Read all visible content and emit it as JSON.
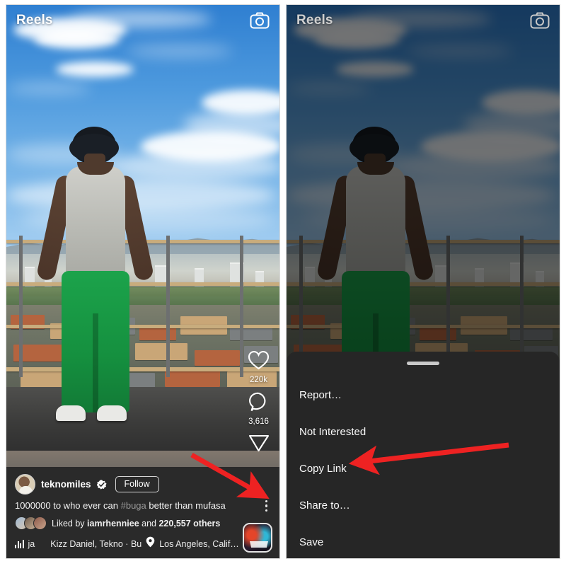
{
  "app": {
    "name": "Instagram Reels",
    "screen_title": "Reels"
  },
  "colors": {
    "annotation_arrow": "#ee2222",
    "sheet_background": "#262626",
    "caption_background": "#2a2a2a",
    "panel_background": "#000000",
    "text_primary": "#ffffff",
    "hashtag": "#9a9a9a"
  },
  "left_panel": {
    "label": "reels-feed-screen",
    "topbar": {
      "title": "Reels",
      "camera_icon": "camera-icon"
    },
    "actions": [
      {
        "icon": "heart-icon",
        "name": "like-button",
        "count": "220k"
      },
      {
        "icon": "comment-icon",
        "name": "comment-button",
        "count": "3,616"
      },
      {
        "icon": "share-icon",
        "name": "share-button",
        "count": ""
      }
    ],
    "post": {
      "username": "teknomiles",
      "verified_icon": "verified-badge-icon",
      "follow_label": "Follow",
      "caption_before_tag": "1000000 to who ever can ",
      "caption_hashtag": "#buga",
      "caption_after_tag": " better than mufasa",
      "more_options_icon": "three-dot-menu-icon",
      "liked_by_prefix": "Liked by ",
      "liked_by_user": "iamrhenniee",
      "liked_by_middle": " and ",
      "liked_by_count": "220,557 others",
      "audio_icon": "audio-waveform-icon",
      "audio_text": "Kizz Daniel, Tekno · Bu",
      "audio_language_tag": "ja",
      "location_icon": "location-pin-icon",
      "location_text": "Los Angeles, Calif…",
      "sponsor_thumbnail": "buga-game-thumbnail"
    },
    "annotation": {
      "name": "arrow-to-three-dot-menu",
      "color": "#ee2222",
      "direction": "down-right",
      "points_to": "three-dot-menu-icon"
    }
  },
  "right_panel": {
    "label": "reels-options-sheet-screen",
    "topbar": {
      "title": "Reels",
      "camera_icon": "camera-icon"
    },
    "sheet": {
      "handle": "sheet-drag-handle",
      "items": [
        {
          "label": "Report…",
          "name": "menu-item-report"
        },
        {
          "label": "Not Interested",
          "name": "menu-item-not-interested"
        },
        {
          "label": "Copy Link",
          "name": "menu-item-copy-link"
        },
        {
          "label": "Share to…",
          "name": "menu-item-share-to"
        },
        {
          "label": "Save",
          "name": "menu-item-save"
        }
      ]
    },
    "annotation": {
      "name": "arrow-to-copy-link",
      "color": "#ee2222",
      "direction": "left",
      "points_to": "menu-item-copy-link"
    }
  }
}
